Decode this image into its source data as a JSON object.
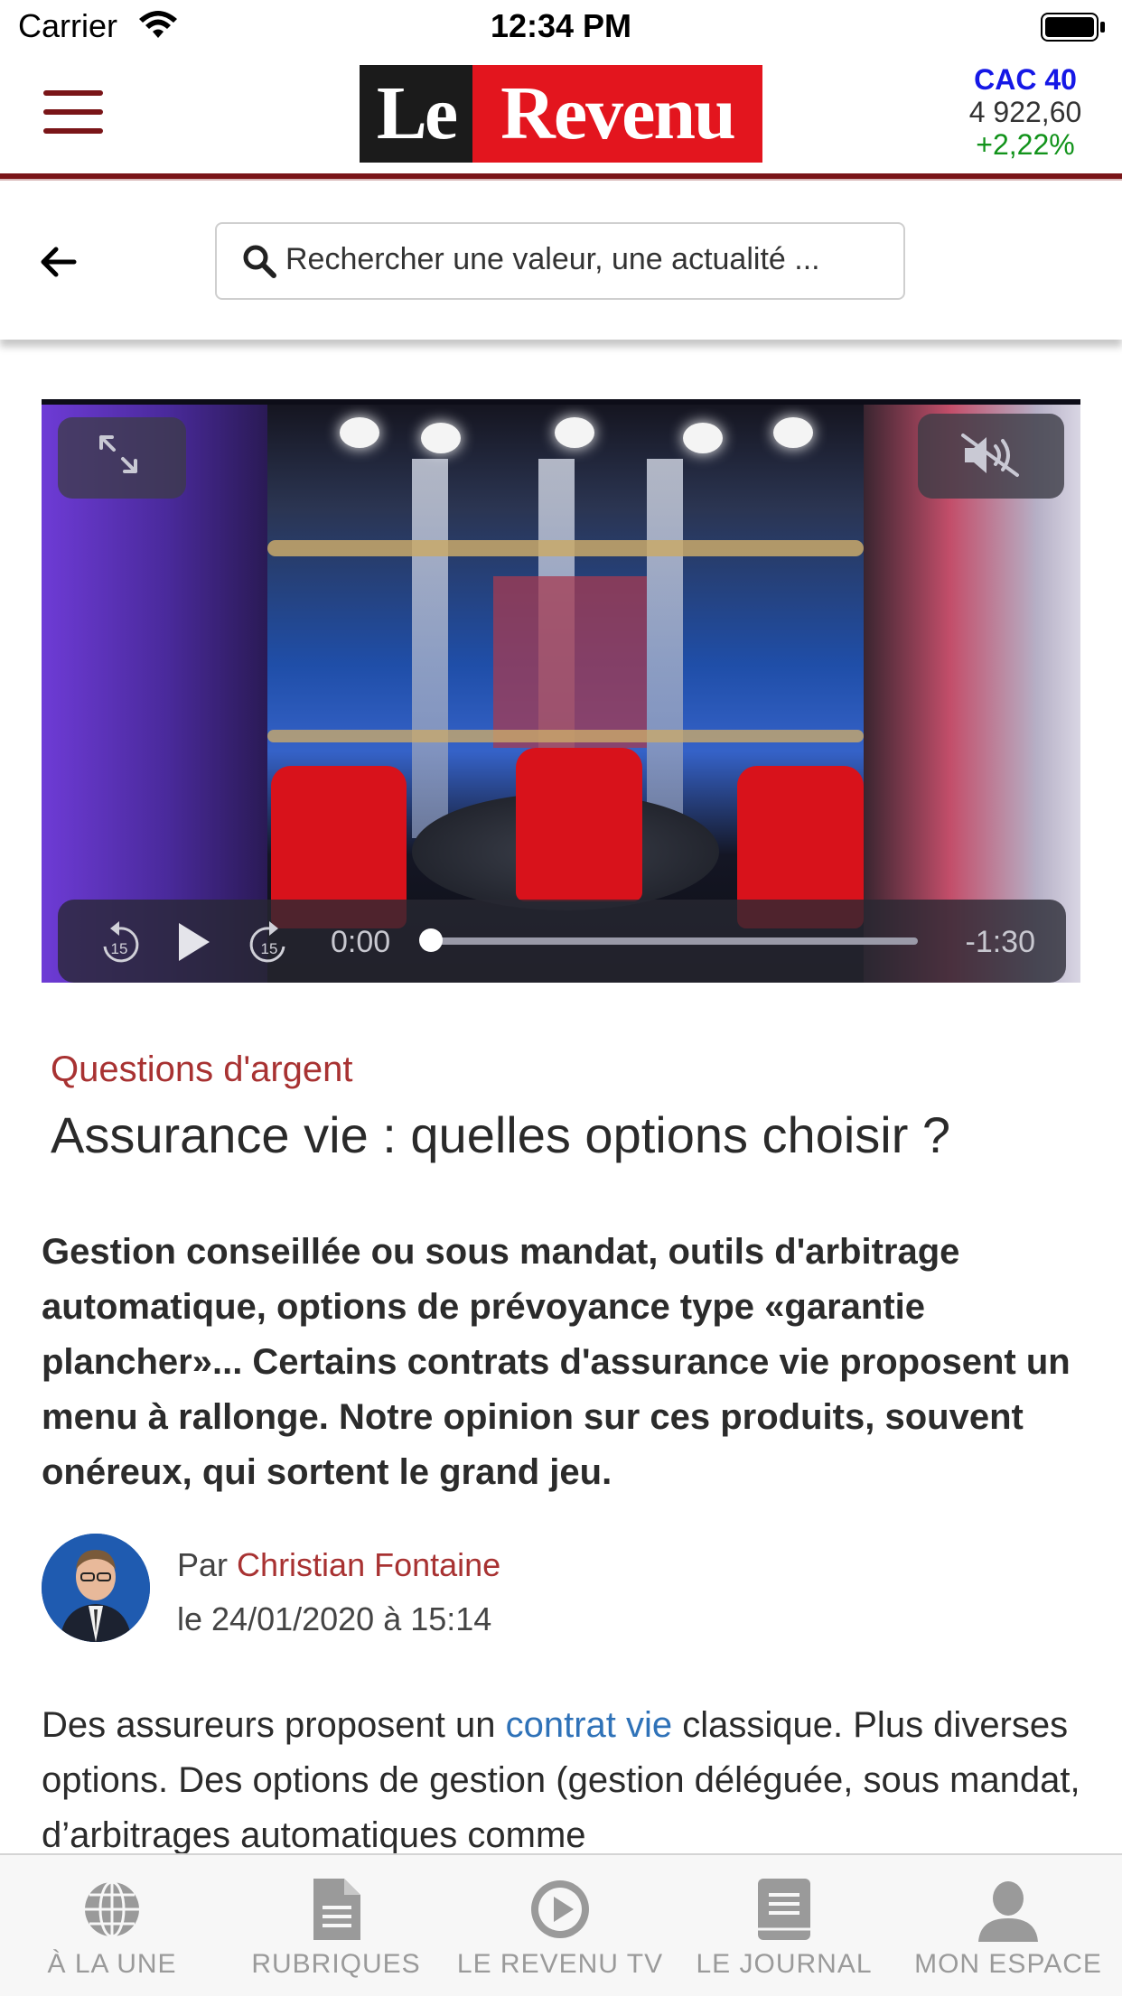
{
  "status_bar": {
    "carrier": "Carrier",
    "time": "12:34 PM"
  },
  "header": {
    "logo_le": "Le",
    "logo_revenu": "Revenu",
    "index": {
      "name": "CAC 40",
      "value": "4 922,60",
      "change": "+2,22%"
    }
  },
  "search": {
    "placeholder": "Rechercher une valeur, une actualité ..."
  },
  "video": {
    "current_time": "0:00",
    "remaining_time": "-1:30",
    "skip_seconds": "15",
    "progress": 0
  },
  "article": {
    "category": "Questions d'argent",
    "title": "Assurance vie : quelles options choisir ?",
    "lead": "Gestion conseillée ou sous mandat, outils d'arbitrage automatique, options de prévoyance type «garantie plancher»... Certains contrats d'assurance vie proposent un menu à rallonge. Notre opinion sur ces produits, souvent onéreux, qui sortent le grand jeu.",
    "author_prefix": "Par",
    "author_name": "Christian Fontaine",
    "date": "le 24/01/2020 à 15:14",
    "body_before_link": "Des assureurs proposent un ",
    "body_link": "contrat vie",
    "body_after_link": " classique. Plus diverses options. Des options de gestion (gestion déléguée, sous mandat, d’arbitrages automatiques comme"
  },
  "tabbar": {
    "items": [
      {
        "label": "À LA UNE",
        "icon": "globe-icon"
      },
      {
        "label": "RUBRIQUES",
        "icon": "document-icon"
      },
      {
        "label": "LE REVENU TV",
        "icon": "play-circle-icon"
      },
      {
        "label": "LE JOURNAL",
        "icon": "book-icon"
      },
      {
        "label": "MON ESPACE",
        "icon": "user-icon"
      }
    ]
  },
  "colors": {
    "brand_red": "#e3151e",
    "header_rule": "#7a1518",
    "index_blue": "#1518e6",
    "index_green": "#12931b",
    "category_red": "#a83232",
    "link_blue": "#2f72b8"
  }
}
